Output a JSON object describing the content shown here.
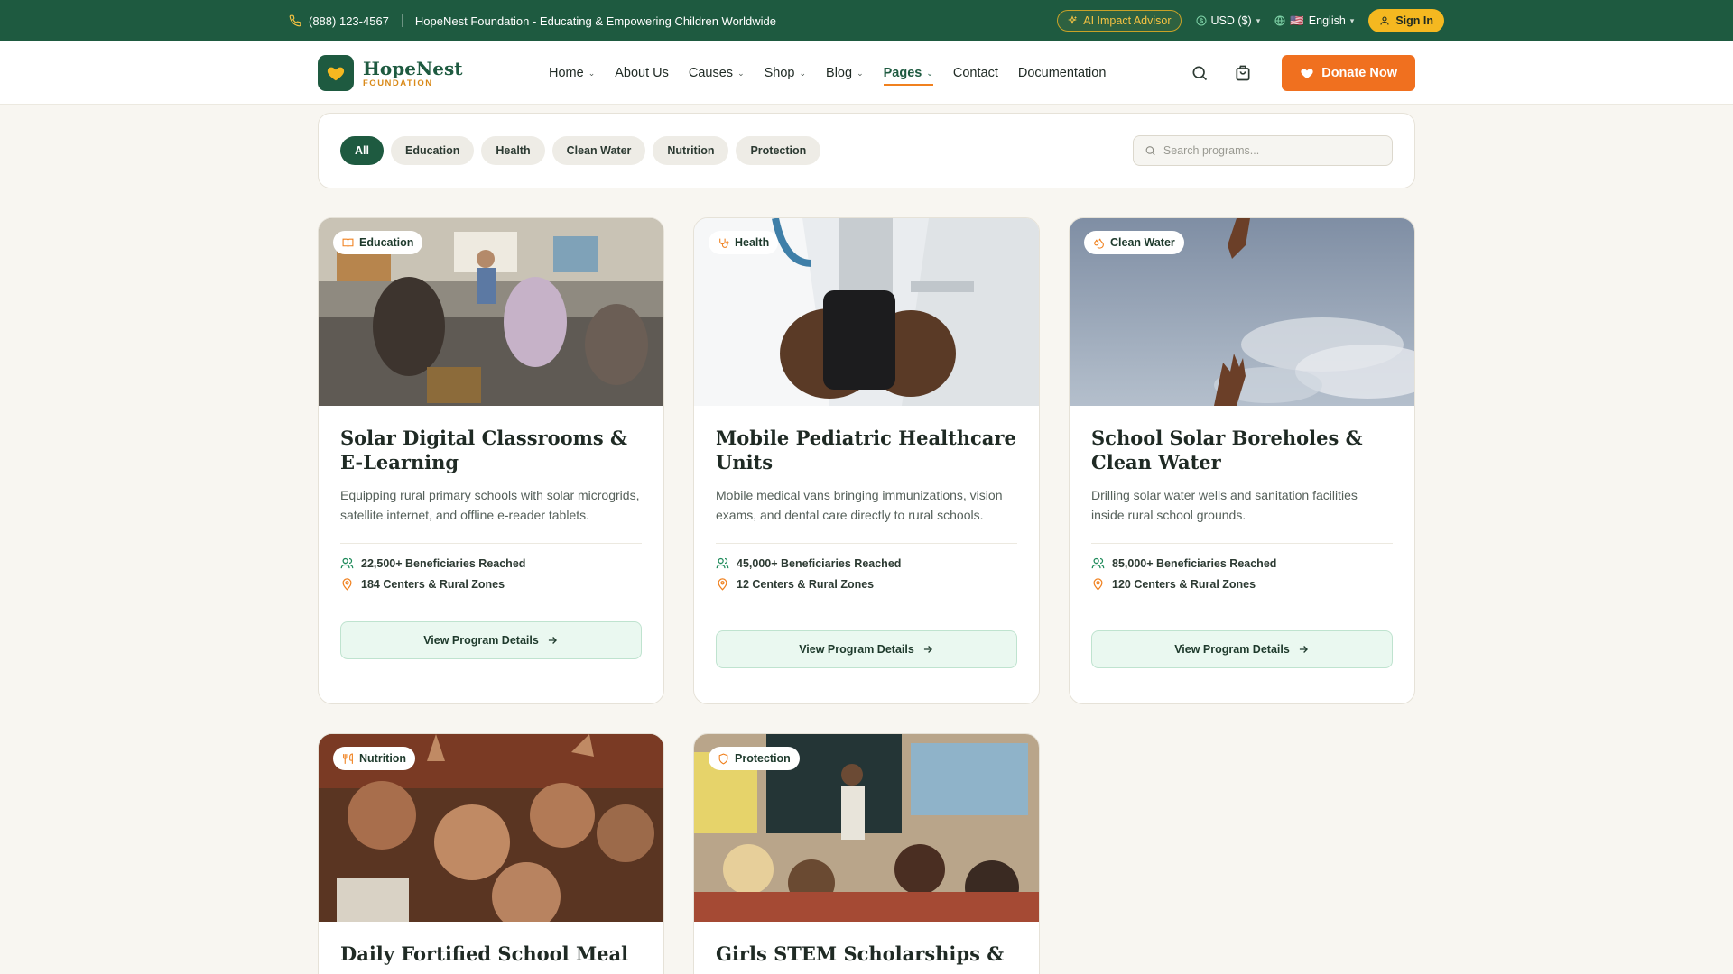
{
  "topbar": {
    "phone": "(888) 123-4567",
    "tagline": "HopeNest Foundation - Educating & Empowering Children Worldwide",
    "ai_advisor": "AI Impact Advisor",
    "currency": "USD ($)",
    "language_flag": "🇺🇸",
    "language": "English",
    "sign_in": "Sign In"
  },
  "brand": {
    "name": "HopeNest",
    "sub": "FOUNDATION",
    "primary_color": "#1e5a40",
    "accent_color": "#f0701f",
    "gold_color": "#f5b820"
  },
  "nav": {
    "items": [
      {
        "label": "Home",
        "dropdown": true
      },
      {
        "label": "About Us",
        "dropdown": false
      },
      {
        "label": "Causes",
        "dropdown": true
      },
      {
        "label": "Shop",
        "dropdown": true
      },
      {
        "label": "Blog",
        "dropdown": true
      },
      {
        "label": "Pages",
        "dropdown": true,
        "active": true
      },
      {
        "label": "Contact",
        "dropdown": false
      },
      {
        "label": "Documentation",
        "dropdown": false
      }
    ],
    "donate": "Donate Now"
  },
  "filters": {
    "chips": [
      "All",
      "Education",
      "Health",
      "Clean Water",
      "Nutrition",
      "Protection"
    ],
    "active": "All",
    "search_placeholder": "Search programs..."
  },
  "programs": [
    {
      "tag": "Education",
      "tag_icon": "book-icon",
      "title": "Solar Digital Classrooms & E-Learning",
      "description": "Equipping rural primary schools with solar microgrids, satellite internet, and offline e-reader tablets.",
      "beneficiaries": "22,500+ Beneficiaries Reached",
      "centers": "184 Centers & Rural Zones",
      "cta": "View Program Details"
    },
    {
      "tag": "Health",
      "tag_icon": "stethoscope-icon",
      "title": "Mobile Pediatric Healthcare Units",
      "description": "Mobile medical vans bringing immunizations, vision exams, and dental care directly to rural schools.",
      "beneficiaries": "45,000+ Beneficiaries Reached",
      "centers": "12 Centers & Rural Zones",
      "cta": "View Program Details"
    },
    {
      "tag": "Clean Water",
      "tag_icon": "droplets-icon",
      "title": "School Solar Boreholes & Clean Water",
      "description": "Drilling solar water wells and sanitation facilities inside rural school grounds.",
      "beneficiaries": "85,000+ Beneficiaries Reached",
      "centers": "120 Centers & Rural Zones",
      "cta": "View Program Details"
    },
    {
      "tag": "Nutrition",
      "tag_icon": "utensils-icon",
      "title": "Daily Fortified School Meal"
    },
    {
      "tag": "Protection",
      "tag_icon": "shield-icon",
      "title": "Girls STEM Scholarships &"
    }
  ]
}
